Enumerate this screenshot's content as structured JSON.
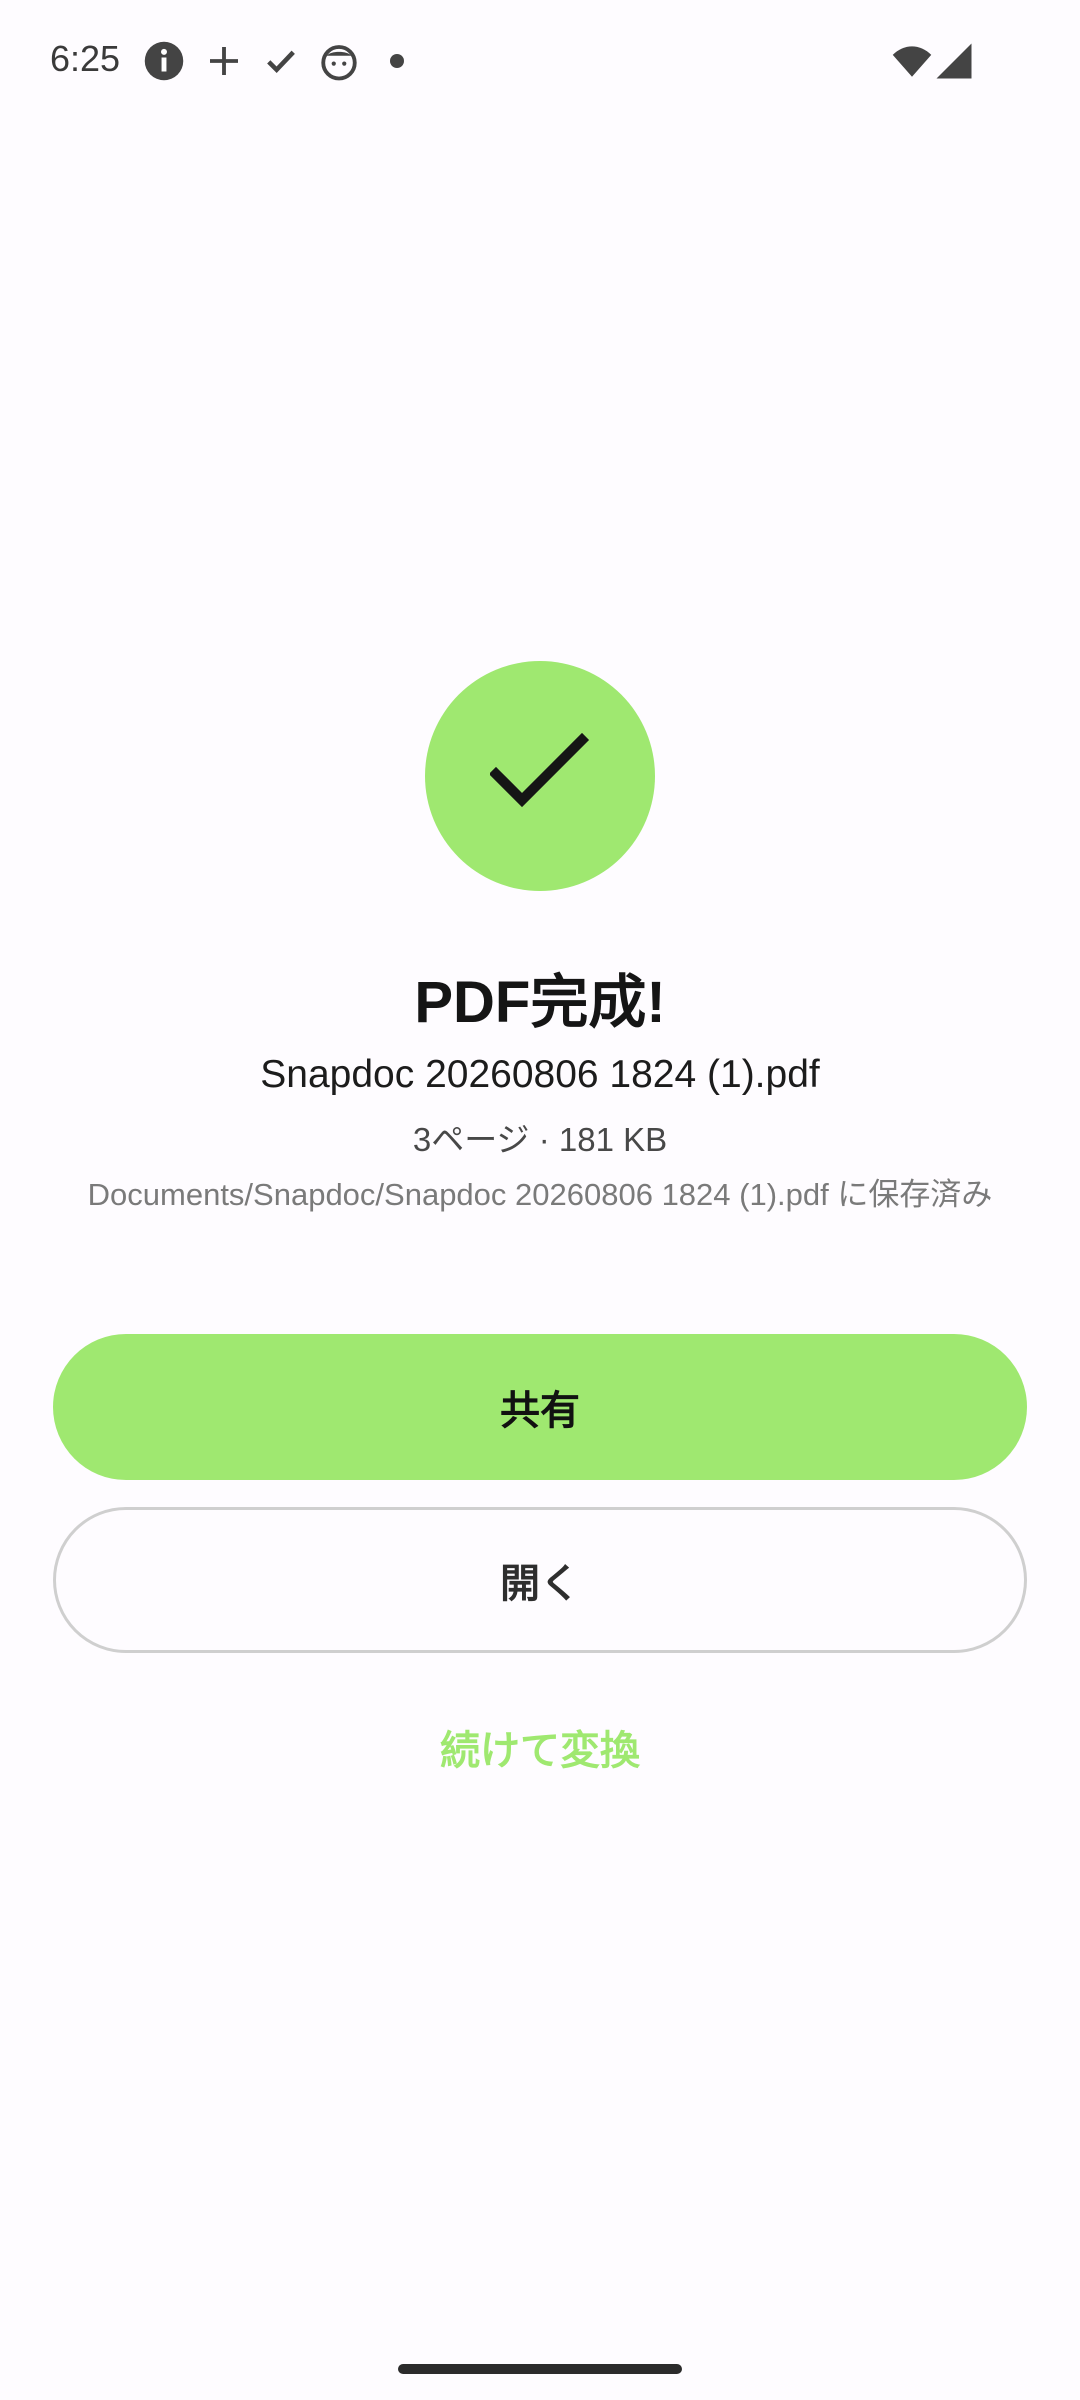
{
  "status_bar": {
    "time": "6:25",
    "icons": [
      "info-icon",
      "plus-icon",
      "check-icon",
      "cat-face-icon",
      "dot-icon",
      "wifi-icon",
      "signal-icon"
    ]
  },
  "colors": {
    "accent": "#9fe870",
    "background": "#fefcff",
    "text_primary": "#151515",
    "text_secondary": "#7a7a7a"
  },
  "result": {
    "title": "PDF完成!",
    "file_name": "Snapdoc 20260806 1824 (1).pdf",
    "file_meta": "3ページ · 181 KB",
    "save_path": "Documents/Snapdoc/Snapdoc 20260806 1824 (1).pdf に保存済み"
  },
  "actions": {
    "share_label": "共有",
    "open_label": "開く",
    "continue_label": "続けて変換"
  }
}
